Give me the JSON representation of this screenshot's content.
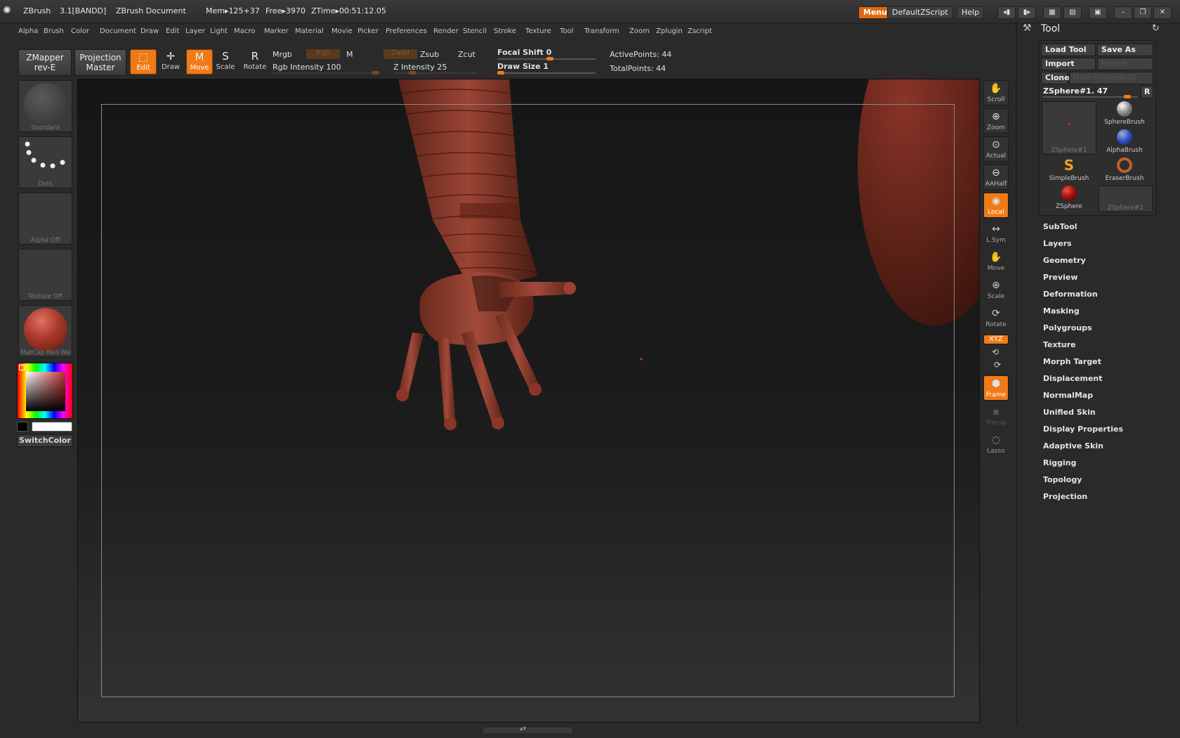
{
  "titlebar": {
    "app": "ZBrush",
    "version": "3.1[BANDD]",
    "document": "ZBrush Document",
    "mem": "Mem▸125+37",
    "free": "Free▸3970",
    "ztime": "ZTime▸00:51:12.05",
    "menus_btn": "Menus",
    "script_btn": "DefaultZScript",
    "help_btn": "Help"
  },
  "menubar": [
    "Alpha",
    "Brush",
    "Color",
    "Document",
    "Draw",
    "Edit",
    "Layer",
    "Light",
    "Macro",
    "Marker",
    "Material",
    "Movie",
    "Picker",
    "Preferences",
    "Render",
    "Stencil",
    "Stroke",
    "Texture",
    "Tool",
    "Transform",
    "Zoom",
    "Zplugin",
    "Zscript"
  ],
  "shelf": {
    "zmapper_line1": "ZMapper",
    "zmapper_line2": "rev-E",
    "projection_line1": "Projection",
    "projection_line2": "Master",
    "edit": "Edit",
    "draw": "Draw",
    "move": "Move",
    "scale": "Scale",
    "rotate": "Rotate",
    "mrgb": "Mrgb",
    "rgb": "Rgb",
    "m": "M",
    "rgb_intensity": "Rgb  Intensity 100",
    "zadd": "Zadd",
    "zsub": "Zsub",
    "zcut": "Zcut",
    "z_intensity": "Z  Intensity 25",
    "focal_shift": "Focal Shift 0",
    "draw_size": "Draw Size 1",
    "active_points": "ActivePoints: 44",
    "total_points": "TotalPoints: 44"
  },
  "left_panel": {
    "standard": "Standard",
    "dots": "Dots",
    "alpha_off": "Alpha  Off",
    "texture_off": "Texture  Off",
    "matcap": "MatCap  Red  Wa",
    "switchcolor": "SwitchColor"
  },
  "right_toolbar": {
    "scroll": "Scroll",
    "zoom": "Zoom",
    "actual": "Actual",
    "aahalf": "AAHalf",
    "local": "Local",
    "lsym": "L.Sym",
    "move": "Move",
    "scale": "Scale",
    "rotate": "Rotate",
    "xyz": "XYZ",
    "frame": "Frame",
    "transp": "Transp",
    "lasso": "Lasso"
  },
  "tool_panel": {
    "title": "Tool",
    "load_tool": "Load Tool",
    "save_as": "Save As",
    "import": "Import",
    "export": "Export",
    "clone": "Clone",
    "make_polymesh": "Make PolyMesh3D",
    "current_tool": "ZSphere#1. 47",
    "r_btn": "R",
    "brushes": [
      {
        "name": "ZSphere#1"
      },
      {
        "name": "SphereBrush"
      },
      {
        "name": "AlphaBrush"
      },
      {
        "name": "SimpleBrush"
      },
      {
        "name": "EraserBrush"
      },
      {
        "name": "ZSphere"
      },
      {
        "name": "ZSphere#1"
      }
    ],
    "subpalettes": [
      "SubTool",
      "Layers",
      "Geometry",
      "Preview",
      "Deformation",
      "Masking",
      "Polygroups",
      "Texture",
      "Morph Target",
      "Displacement",
      "NormalMap",
      "Unified Skin",
      "Display Properties",
      "Adaptive Skin",
      "Rigging",
      "Topology",
      "Projection"
    ]
  },
  "colors": {
    "accent": "#f07a18",
    "model": "#8a3a2c"
  }
}
